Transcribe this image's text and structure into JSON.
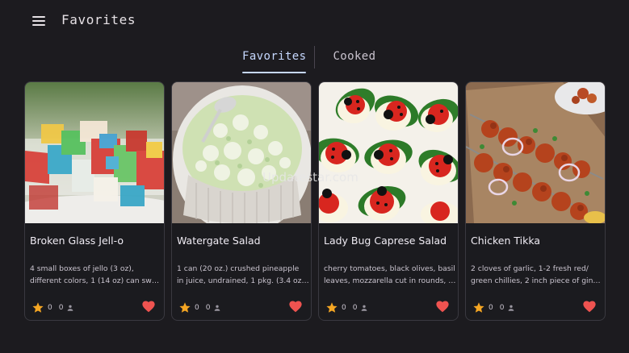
{
  "header": {
    "title": "Favorites",
    "menu_icon": "hamburger-menu-icon"
  },
  "tabs": [
    {
      "label": "Favorites",
      "active": true
    },
    {
      "label": "Cooked",
      "active": false
    }
  ],
  "accent_color": "#c6d8ff",
  "star_color": "#f5a623",
  "heart_color": "#ef5350",
  "recipes": [
    {
      "name": "Broken Glass Jell-o",
      "desc_line1": "4 small boxes of jello (3 oz),",
      "desc_line2": "different colors, 1 (14 oz) can swe...",
      "rating": "0",
      "cooked": "0"
    },
    {
      "name": "Watergate Salad",
      "desc_line1": "1 can (20 oz.) crushed pineapple",
      "desc_line2": "in juice, undrained, 1 pkg. (3.4 oz.)...",
      "rating": "0",
      "cooked": "0"
    },
    {
      "name": "Lady Bug Caprese Salad",
      "desc_line1": "cherry tomatoes, black olives, basil",
      "desc_line2": "leaves, mozzarella cut in rounds, b...",
      "rating": "0",
      "cooked": "0"
    },
    {
      "name": "Chicken Tikka",
      "desc_line1": "2 cloves of garlic, 1-2 fresh red/",
      "desc_line2": "green chillies, 2 inch piece of ging...",
      "rating": "0",
      "cooked": "0"
    }
  ],
  "watermark": "Updatestar.com"
}
